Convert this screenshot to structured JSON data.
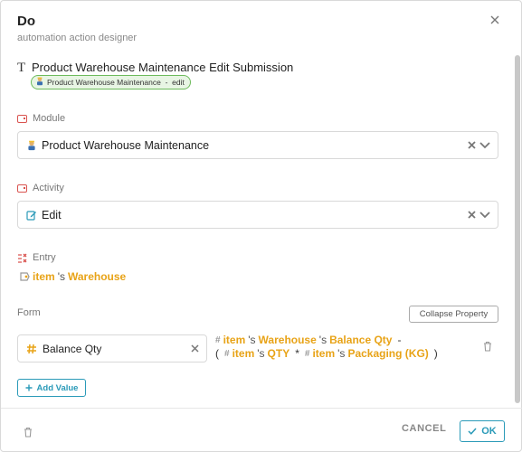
{
  "header": {
    "title": "Do",
    "subtitle": "automation action designer"
  },
  "action": {
    "title": "Product Warehouse Maintenance Edit Submission",
    "tag": "Product Warehouse Maintenance  -  edit"
  },
  "module": {
    "label": "Module",
    "value": "Product Warehouse Maintenance"
  },
  "activity": {
    "label": "Activity",
    "value": "Edit"
  },
  "entry": {
    "label": "Entry",
    "obj": "item",
    "possessive": "'s",
    "field": "Warehouse"
  },
  "form": {
    "label": "Form",
    "collapse_label": "Collapse Property",
    "property": "Balance Qty",
    "expression": {
      "line1": {
        "obj": "item",
        "p1": "'s",
        "f1": "Warehouse",
        "p2": "'s",
        "f2": "Balance Qty",
        "op": "-"
      },
      "line2": {
        "open": "(",
        "obj1": "item",
        "p1": "'s",
        "f1": "QTY",
        "op": "*",
        "obj2": "item",
        "p2": "'s",
        "f2": "Packaging (KG)",
        "close": ")"
      }
    },
    "add_value_label": "Add Value"
  },
  "footer": {
    "cancel_label": "CANCEL",
    "ok_label": "OK"
  },
  "colors": {
    "accent": "#2a9ab8",
    "keyword": "#e8a317",
    "tag_bg": "#e8f5e4",
    "tag_border": "#6dbb5c",
    "section_icon": "#d9534f"
  },
  "icons": {
    "close": "close-icon",
    "title": "text-type-icon",
    "module_section": "module-icon",
    "worker": "worker-icon",
    "chevron": "chevron-down-icon",
    "edit": "edit-icon",
    "entry": "entry-icon",
    "property": "hash-field-icon",
    "trash": "trash-icon",
    "add": "plus-icon",
    "ok": "check-icon"
  }
}
